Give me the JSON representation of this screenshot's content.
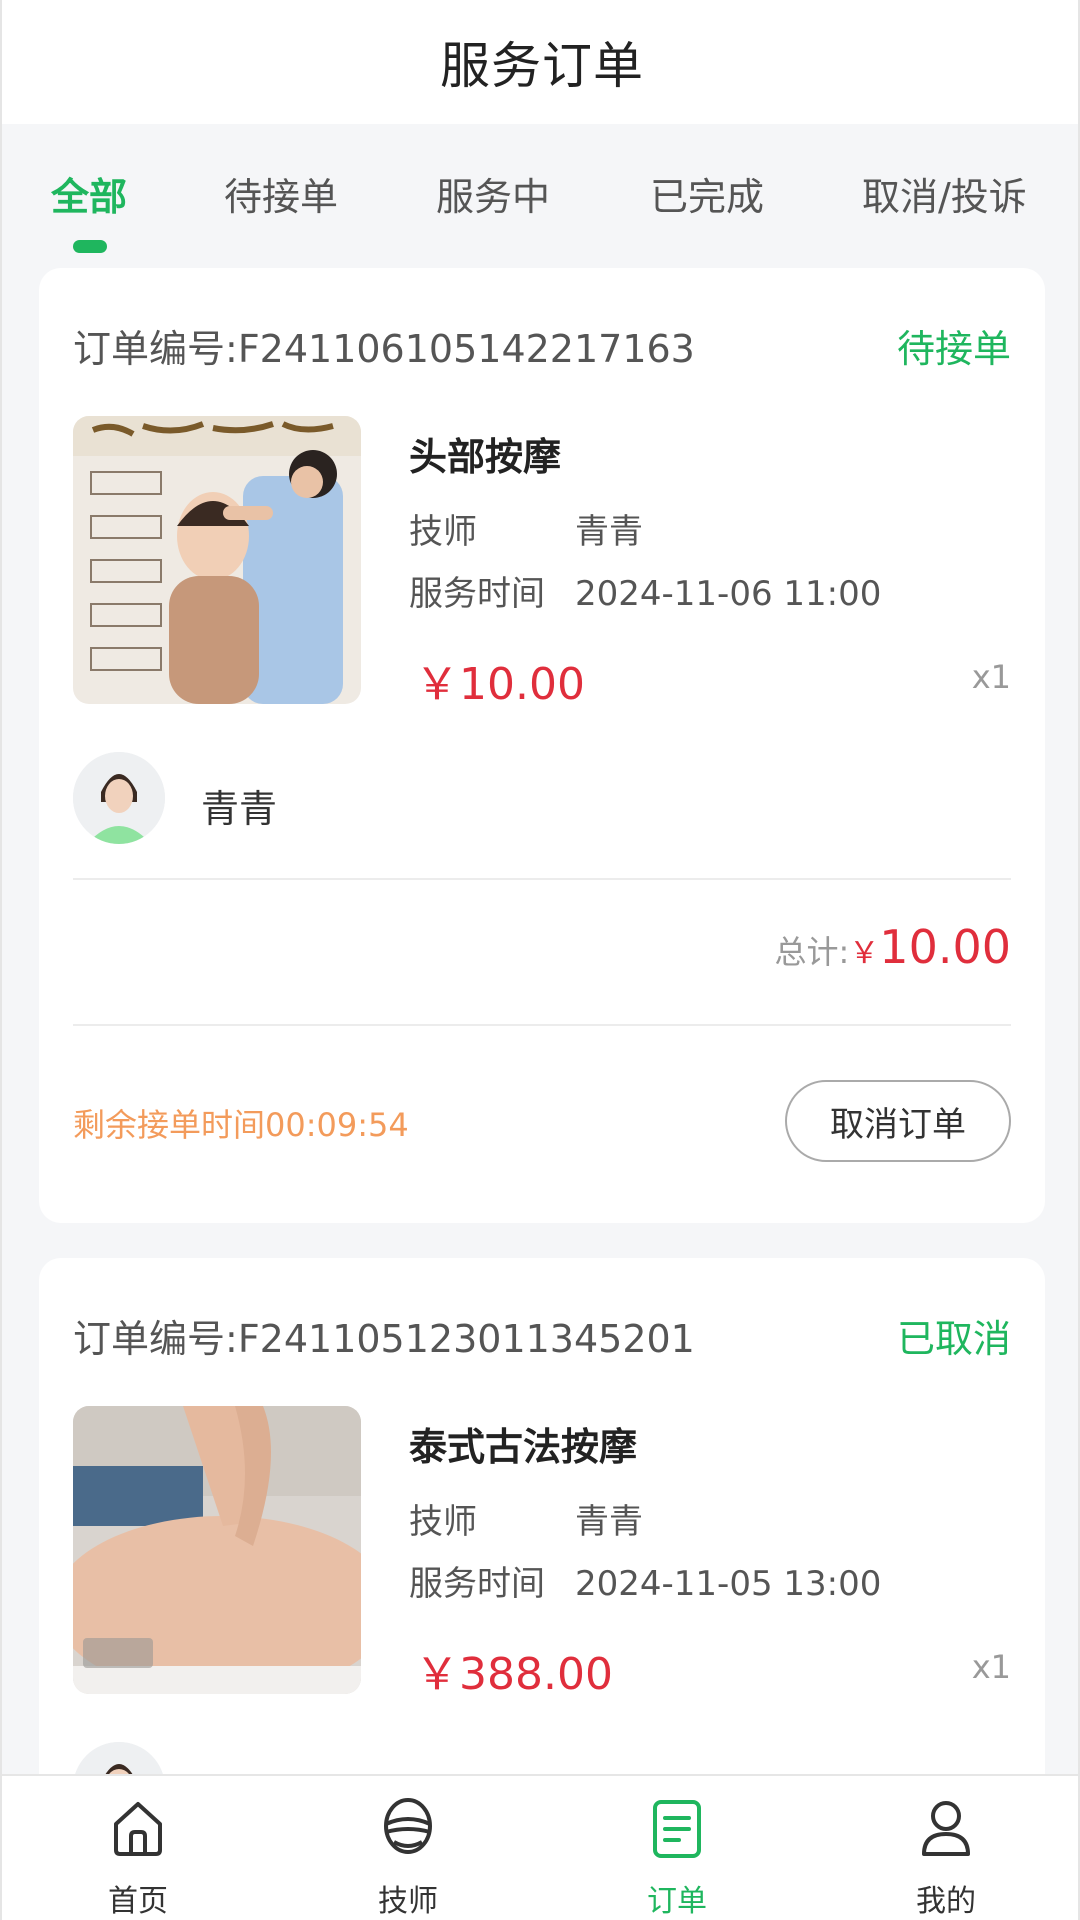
{
  "header": {
    "title": "服务订单"
  },
  "tabs": [
    {
      "label": "全部",
      "active": true
    },
    {
      "label": "待接单",
      "active": false
    },
    {
      "label": "服务中",
      "active": false
    },
    {
      "label": "已完成",
      "active": false
    },
    {
      "label": "取消/投诉",
      "active": false
    }
  ],
  "orders": [
    {
      "order_no_label": "订单编号:",
      "order_no": "F241106105142217163",
      "status": "待接单",
      "service_name": "头部按摩",
      "tech_label": "技师",
      "tech_value": "青青",
      "time_label": "服务时间",
      "time_value": "2024-11-06 11:00",
      "price": "￥10.00",
      "qty": "x1",
      "technician_name": "青青",
      "total_label": "总计:",
      "total_currency": "￥",
      "total_amount": "10.00",
      "countdown": "剩余接单时间00:09:54",
      "cancel_button": "取消订单"
    },
    {
      "order_no_label": "订单编号:",
      "order_no": "F241105123011345201",
      "status": "已取消",
      "service_name": "泰式古法按摩",
      "tech_label": "技师",
      "tech_value": "青青",
      "time_label": "服务时间",
      "time_value": "2024-11-05 13:00",
      "price": "￥388.00",
      "qty": "x1"
    }
  ],
  "bottom_nav": [
    {
      "label": "首页",
      "icon": "home-icon",
      "active": false
    },
    {
      "label": "技师",
      "icon": "technician-icon",
      "active": false
    },
    {
      "label": "订单",
      "icon": "order-icon",
      "active": true
    },
    {
      "label": "我的",
      "icon": "profile-icon",
      "active": false
    }
  ],
  "colors": {
    "accent": "#1fb65e",
    "price": "#e02e3c",
    "countdown": "#f39b5b",
    "background": "#f5f6f8"
  }
}
